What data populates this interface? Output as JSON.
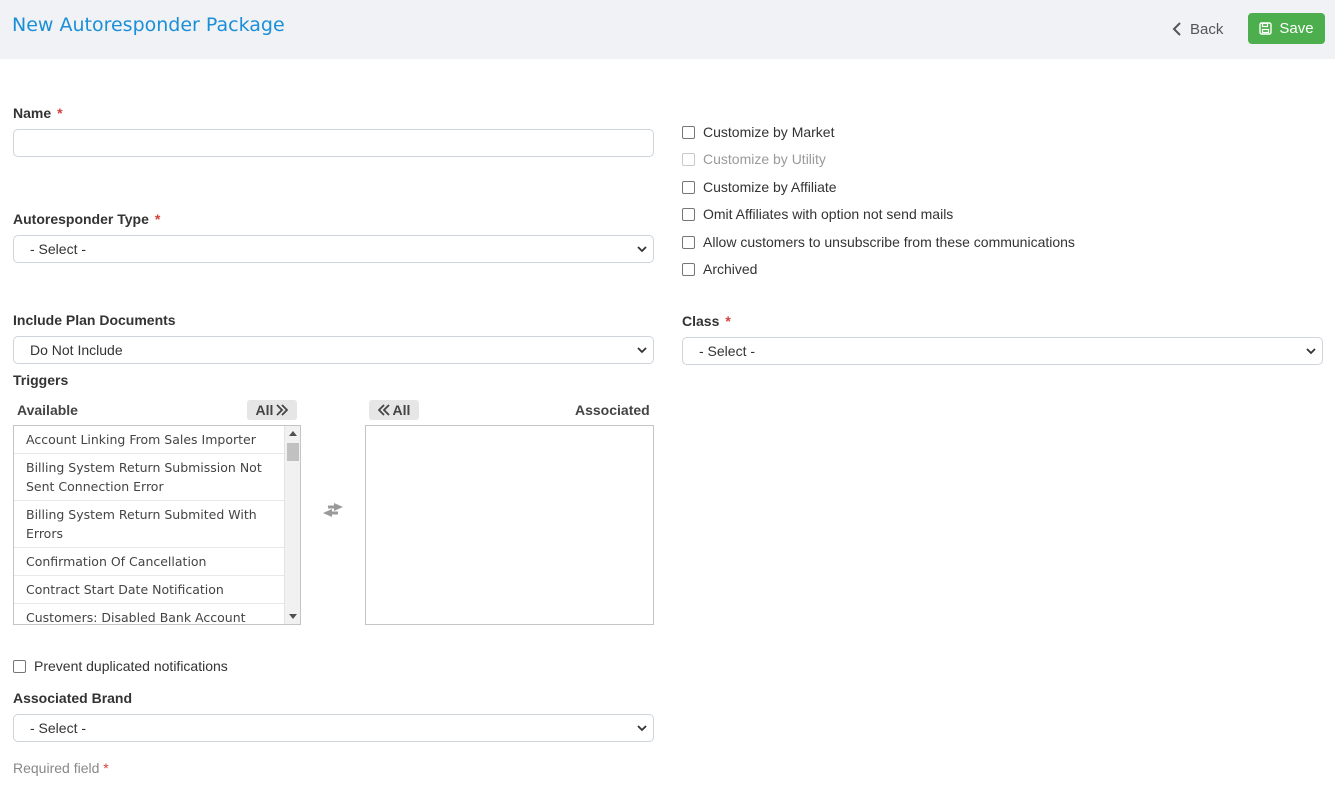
{
  "header": {
    "title": "New Autoresponder Package",
    "back_label": "Back",
    "save_label": "Save"
  },
  "form": {
    "name": {
      "label": "Name",
      "value": "",
      "placeholder": ""
    },
    "autoresponder_type": {
      "label": "Autoresponder Type",
      "selected": "- Select -"
    },
    "include_plan_documents": {
      "label": "Include Plan Documents",
      "selected": "Do Not Include"
    },
    "triggers": {
      "label": "Triggers",
      "available_label": "Available",
      "associated_label": "Associated",
      "move_all_right_label": "All",
      "move_all_left_label": "All",
      "available_items": [
        "Account Linking From Sales Importer",
        "Billing System Return Submission Not Sent Connection Error",
        "Billing System Return Submited With Errors",
        "Confirmation Of Cancellation",
        "Contract Start Date Notification",
        "Customers: Disabled Bank Account"
      ],
      "associated_items": []
    },
    "prevent_duplicated": {
      "label": "Prevent duplicated notifications",
      "checked": false
    },
    "associated_brand": {
      "label": "Associated Brand",
      "selected": "- Select -"
    },
    "class": {
      "label": "Class",
      "selected": "- Select -"
    },
    "options": [
      {
        "label": "Customize by Market",
        "checked": false,
        "disabled": false
      },
      {
        "label": "Customize by Utility",
        "checked": false,
        "disabled": true
      },
      {
        "label": "Customize by Affiliate",
        "checked": false,
        "disabled": false
      },
      {
        "label": "Omit Affiliates with option not send mails",
        "checked": false,
        "disabled": false
      },
      {
        "label": "Allow customers to unsubscribe from these communications",
        "checked": false,
        "disabled": false
      },
      {
        "label": "Archived",
        "checked": false,
        "disabled": false
      }
    ],
    "required_note": "Required field",
    "required_marker": "*"
  },
  "colors": {
    "title": "#1a8fd8",
    "save_button": "#4cae4c",
    "required": "#d43f3a",
    "header_bg": "#f0f2f5"
  }
}
